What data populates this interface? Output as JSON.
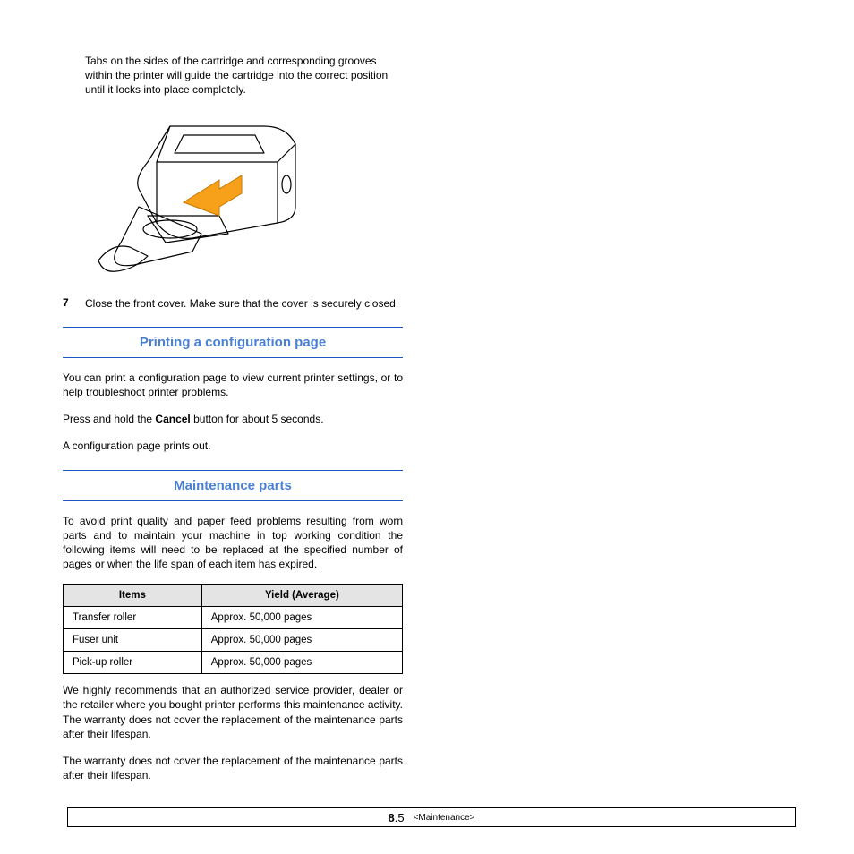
{
  "intro": "Tabs on the sides of the cartridge and corresponding grooves within the printer will guide the cartridge into the correct position until it locks into place completely.",
  "step7": {
    "num": "7",
    "text": "Close the front cover. Make sure that the cover is securely closed."
  },
  "section1": {
    "heading": "Printing a configuration page",
    "para1": "You can print a configuration page to view current printer settings, or to help troubleshoot printer problems.",
    "para2_a": "Press and hold the ",
    "para2_bold": "Cancel",
    "para2_b": " button for about 5 seconds.",
    "para3": "A configuration page prints out."
  },
  "section2": {
    "heading": "Maintenance parts",
    "para1": "To avoid print quality and paper feed problems resulting from worn parts and to maintain your machine in top working condition the following items will need to be replaced at the specified number of pages or when the life span of each item has expired.",
    "table": {
      "head": {
        "items": "Items",
        "yield": "Yield (Average)"
      },
      "rows": [
        {
          "items": "Transfer roller",
          "yield": "Approx. 50,000 pages"
        },
        {
          "items": "Fuser unit",
          "yield": "Approx. 50,000 pages"
        },
        {
          "items": "Pick-up roller",
          "yield": "Approx. 50,000 pages"
        }
      ]
    },
    "para2": "We highly recommends that an authorized service provider, dealer or the retailer where you bought printer performs this maintenance activity.   The warranty does not cover the replacement of the maintenance parts after their lifespan.",
    "para3": "The warranty does not cover the replacement of the maintenance parts after their lifespan."
  },
  "footer": {
    "chapter": "8",
    "page": ".5",
    "label": "<Maintenance>"
  }
}
